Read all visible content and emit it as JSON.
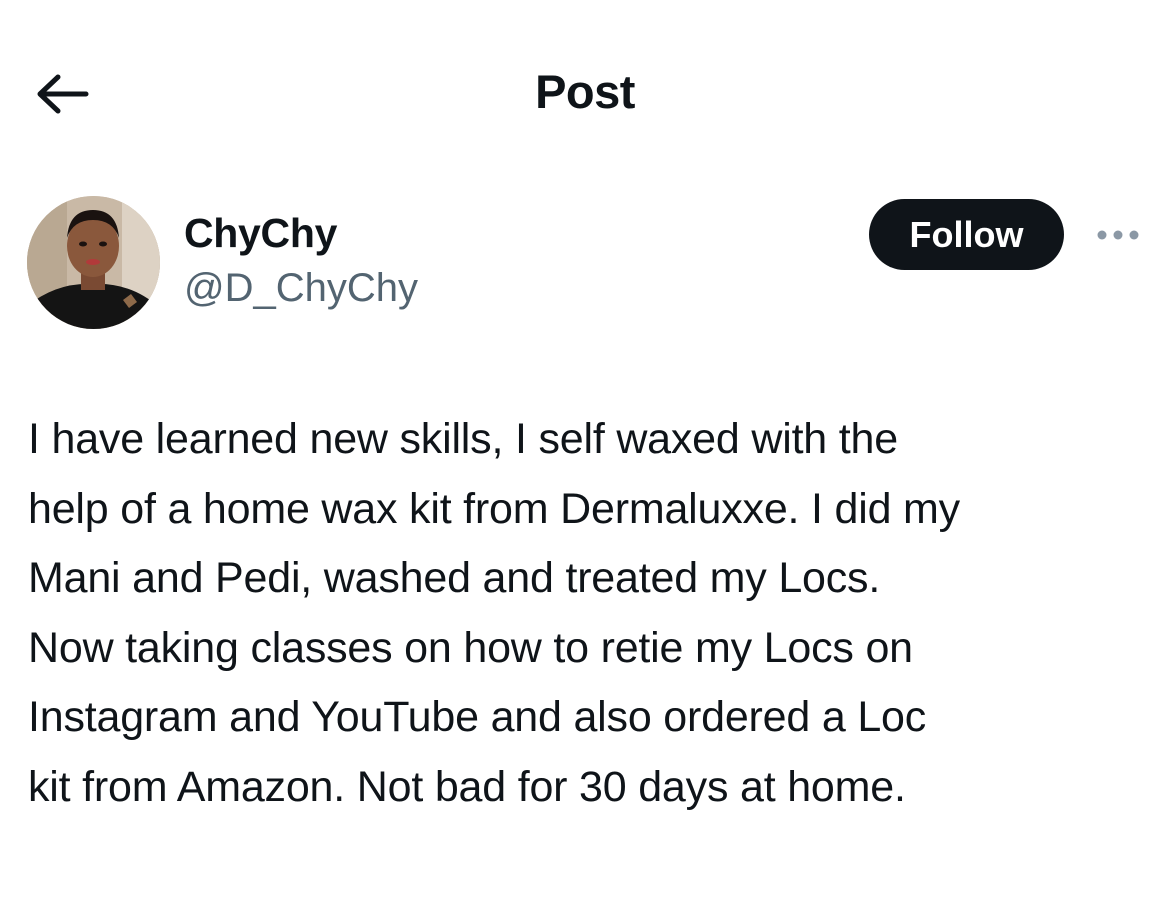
{
  "header": {
    "title": "Post",
    "back_icon": "arrow-left-icon"
  },
  "author": {
    "display_name": "ChyChy",
    "handle": "@D_ChyChy",
    "avatar_icon": "profile-photo"
  },
  "actions": {
    "follow_label": "Follow",
    "more_icon": "more-horizontal-icon"
  },
  "post": {
    "text": "I have learned new skills, I self waxed with the\nhelp of a home wax kit from Dermaluxxe. I did my\nMani and Pedi, washed and treated my Locs.\nNow taking classes on how to retie my Locs on\nInstagram and YouTube and also ordered a Loc\nkit from Amazon. Not bad for 30 days at home."
  },
  "colors": {
    "text_primary": "#0f1419",
    "text_secondary": "#536471",
    "button_bg": "#0f1419",
    "button_text": "#ffffff",
    "background": "#ffffff"
  }
}
